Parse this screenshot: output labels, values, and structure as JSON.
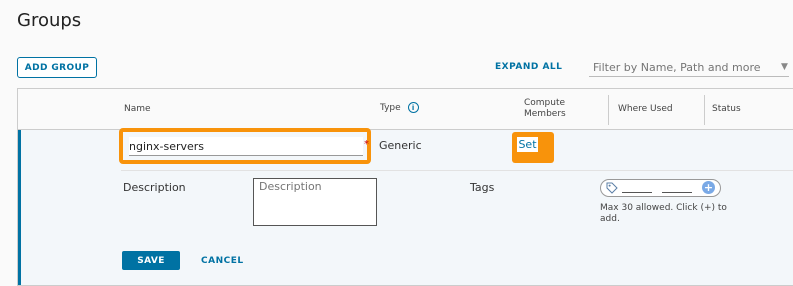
{
  "page": {
    "title": "Groups"
  },
  "toolbar": {
    "add_group_label": "ADD GROUP",
    "expand_all_label": "EXPAND ALL",
    "filter_placeholder": "Filter by Name, Path and more"
  },
  "grid": {
    "columns": {
      "name": "Name",
      "type": "Type",
      "compute_members_line1": "Compute",
      "compute_members_line2": "Members",
      "where_used": "Where Used",
      "status": "Status"
    },
    "row": {
      "name_value": "nginx-servers",
      "required_marker": "*",
      "type": "Generic",
      "compute_members_link": "Set",
      "description_label": "Description",
      "description_placeholder": "Description",
      "tags_label": "Tags",
      "tags_hint": "Max 30 allowed. Click (+) to add.",
      "save_label": "SAVE",
      "cancel_label": "CANCEL"
    }
  },
  "colors": {
    "accent": "#0072a3",
    "highlight": "#f8930b",
    "plus_icon": "#7aa9e6"
  },
  "icons": {
    "info": "info-icon",
    "tag": "tag-icon",
    "plus": "plus-circle-icon",
    "dropdown": "chevron-down-icon"
  }
}
